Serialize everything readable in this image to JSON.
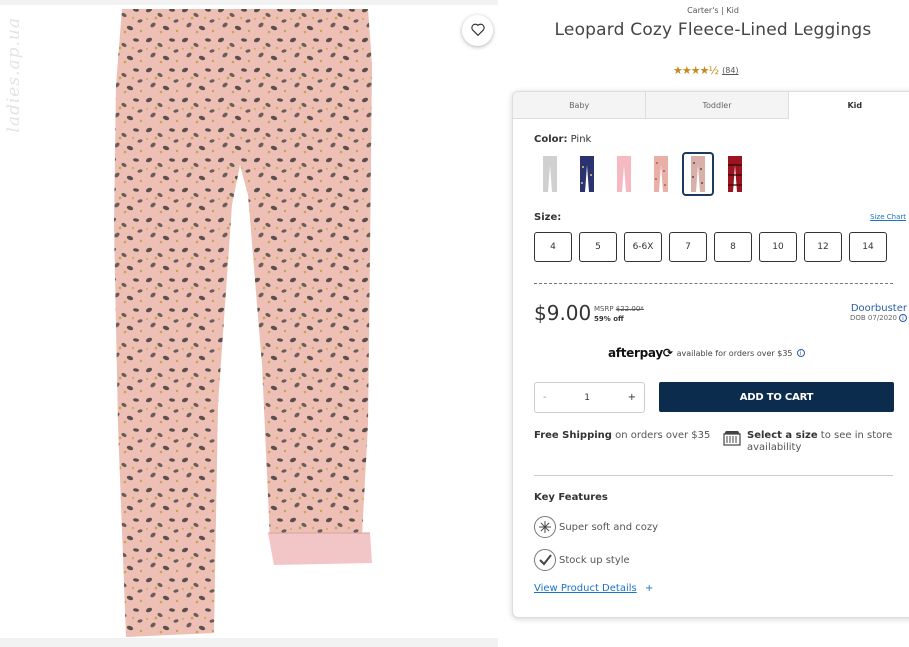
{
  "watermark": "ladies.ap.ua",
  "product": {
    "brand_line": "Carter's | Kid",
    "title": "Leopard Cozy Fleece-Lined Leggings",
    "stars": "★★★★½",
    "review_count": "(84)"
  },
  "tabs": [
    {
      "label": "Baby"
    },
    {
      "label": "Toddler"
    },
    {
      "label": "Kid"
    }
  ],
  "color": {
    "label": "Color:",
    "value": "Pink",
    "swatches": [
      {
        "name": "Gray",
        "hex": "#d0d0d0"
      },
      {
        "name": "Navy",
        "hex": "#2a3270"
      },
      {
        "name": "Light Pink",
        "hex": "#f6b8c1"
      },
      {
        "name": "Pink Print",
        "hex": "#e9b0a8"
      },
      {
        "name": "Leopard",
        "hex": "#d9b0a9"
      },
      {
        "name": "Red Plaid",
        "hex": "#9b1420"
      }
    ]
  },
  "size": {
    "label": "Size:",
    "chart_link": "Size Chart",
    "options": [
      "4",
      "5",
      "6-6X",
      "7",
      "8",
      "10",
      "12",
      "14"
    ]
  },
  "pricing": {
    "price": "$9.00",
    "msrp_label": "MSRP",
    "msrp_value": "$22.00*",
    "discount": "59% off",
    "promo_title": "Doorbuster",
    "promo_sub": "DOB 07/2020"
  },
  "afterpay": {
    "logo": "afterpay⟳",
    "text": "available for orders over $35"
  },
  "cart": {
    "minus": "-",
    "qty": "1",
    "plus": "+",
    "add_label": "ADD TO CART"
  },
  "shipping": {
    "bold": "Free Shipping",
    "rest": "on orders over $35",
    "store_bold": "Select a size",
    "store_rest": "to see in store availability"
  },
  "features": {
    "title": "Key Features",
    "items": [
      {
        "label": "Super soft and cozy",
        "icon": "snowflake-icon"
      },
      {
        "label": "Stock up style",
        "icon": "checkmark-icon"
      }
    ],
    "details_link": "View Product Details",
    "details_plus": "+"
  },
  "colors": {
    "accent_navy": "#0b2c4d",
    "link_blue": "#1a73c9",
    "star_gold": "#c48a1b"
  }
}
